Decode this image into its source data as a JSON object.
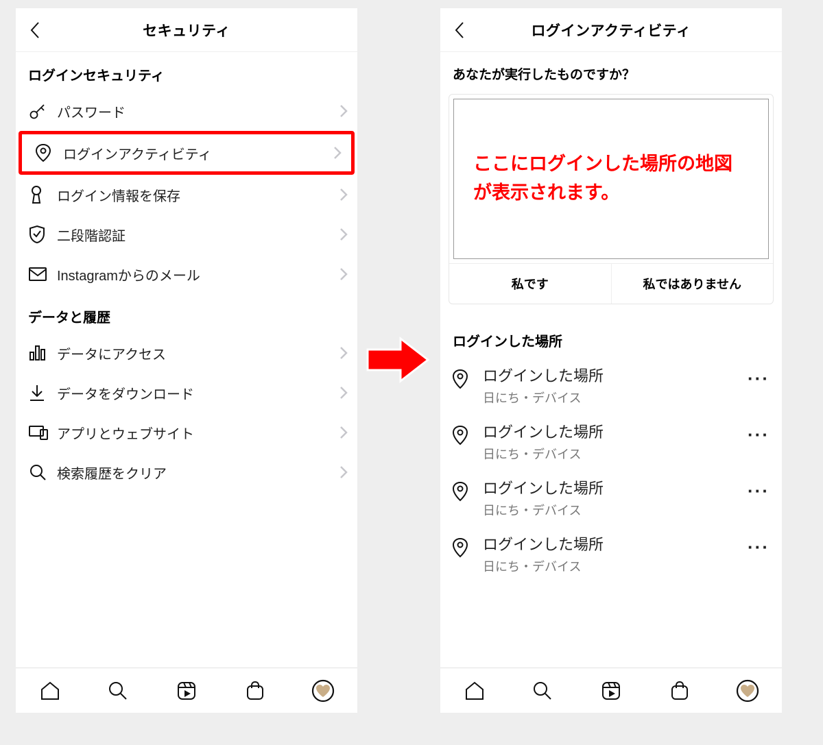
{
  "left": {
    "title": "セキュリティ",
    "section1": "ログインセキュリティ",
    "items1": [
      {
        "label": "パスワード"
      },
      {
        "label": "ログインアクティビティ"
      },
      {
        "label": "ログイン情報を保存"
      },
      {
        "label": "二段階認証"
      },
      {
        "label": "Instagramからのメール"
      }
    ],
    "section2": "データと履歴",
    "items2": [
      {
        "label": "データにアクセス"
      },
      {
        "label": "データをダウンロード"
      },
      {
        "label": "アプリとウェブサイト"
      },
      {
        "label": "検索履歴をクリア"
      }
    ]
  },
  "right": {
    "title": "ログインアクティビティ",
    "question": "あなたが実行したものですか？",
    "map_note": "ここにログインした場所の地図が表示されます。",
    "btn_me": "私です",
    "btn_not_me": "私ではありません",
    "section": "ログインした場所",
    "rows": [
      {
        "place": "ログインした場所",
        "meta": "日にち・デバイス"
      },
      {
        "place": "ログインした場所",
        "meta": "日にち・デバイス"
      },
      {
        "place": "ログインした場所",
        "meta": "日にち・デバイス"
      },
      {
        "place": "ログインした場所",
        "meta": "日にち・デバイス"
      }
    ]
  }
}
